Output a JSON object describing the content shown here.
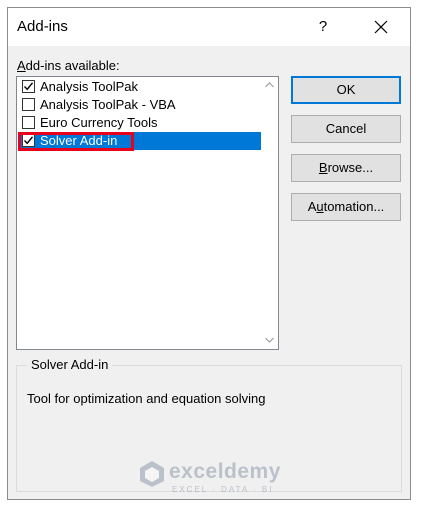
{
  "window": {
    "title": "Add-ins",
    "help_label": "?",
    "close_icon": "close-icon"
  },
  "list": {
    "label_prefix": "A",
    "label_rest": "dd-ins available:",
    "items": [
      {
        "label": "Analysis ToolPak",
        "checked": true,
        "selected": false
      },
      {
        "label": "Analysis ToolPak - VBA",
        "checked": false,
        "selected": false
      },
      {
        "label": "Euro Currency Tools",
        "checked": false,
        "selected": false
      },
      {
        "label": "Solver Add-in",
        "checked": true,
        "selected": true
      }
    ],
    "highlight_color": "#e8001c",
    "selection_color": "#0078d7"
  },
  "buttons": {
    "ok": "OK",
    "cancel": "Cancel",
    "browse_prefix": "B",
    "browse_rest": "rowse...",
    "automation_prefix": "A",
    "automation_mid": "u",
    "automation_rest": "tomation..."
  },
  "description": {
    "title": "Solver Add-in",
    "text": "Tool for optimization and equation solving"
  },
  "watermark": {
    "name": "exceldemy",
    "tagline": "EXCEL · DATA · BI"
  }
}
